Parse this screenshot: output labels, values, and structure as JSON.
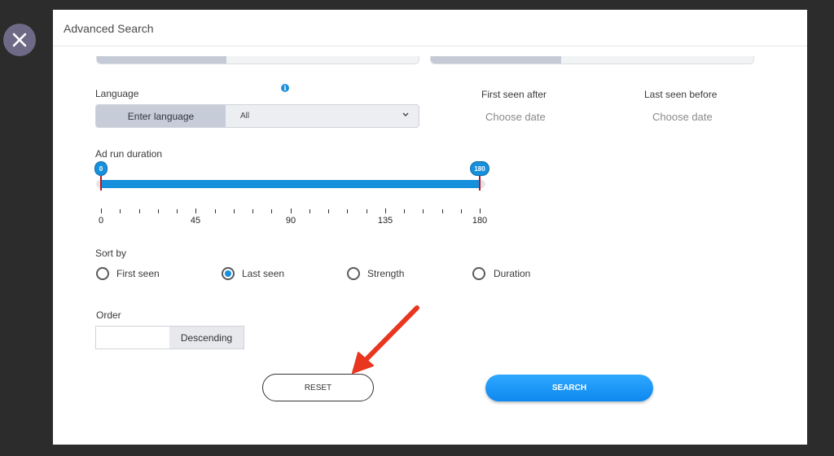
{
  "modal": {
    "title": "Advanced Search"
  },
  "close": {
    "icon": "close-icon"
  },
  "language": {
    "label": "Language",
    "button_label": "Enter language",
    "select_value": "All",
    "info_icon": "info-icon"
  },
  "dates": {
    "first_label": "First seen after",
    "first_placeholder": "Choose date",
    "last_label": "Last seen before",
    "last_placeholder": "Choose date"
  },
  "duration": {
    "label": "Ad run duration",
    "min_value": 0,
    "max_value": 180,
    "min_handle": "0",
    "max_handle": "180",
    "tick_labels": [
      "0",
      "45",
      "90",
      "135",
      "180"
    ]
  },
  "sort": {
    "label": "Sort by",
    "options": [
      {
        "label": "First seen",
        "checked": false
      },
      {
        "label": "Last seen",
        "checked": true
      },
      {
        "label": "Strength",
        "checked": false
      },
      {
        "label": "Duration",
        "checked": false
      }
    ]
  },
  "order": {
    "label": "Order",
    "value": "Descending"
  },
  "actions": {
    "reset": "RESET",
    "search": "SEARCH"
  },
  "colors": {
    "accent": "#1790dc",
    "annotation_arrow": "#e8361f",
    "overlay": "#2c2c2c"
  }
}
